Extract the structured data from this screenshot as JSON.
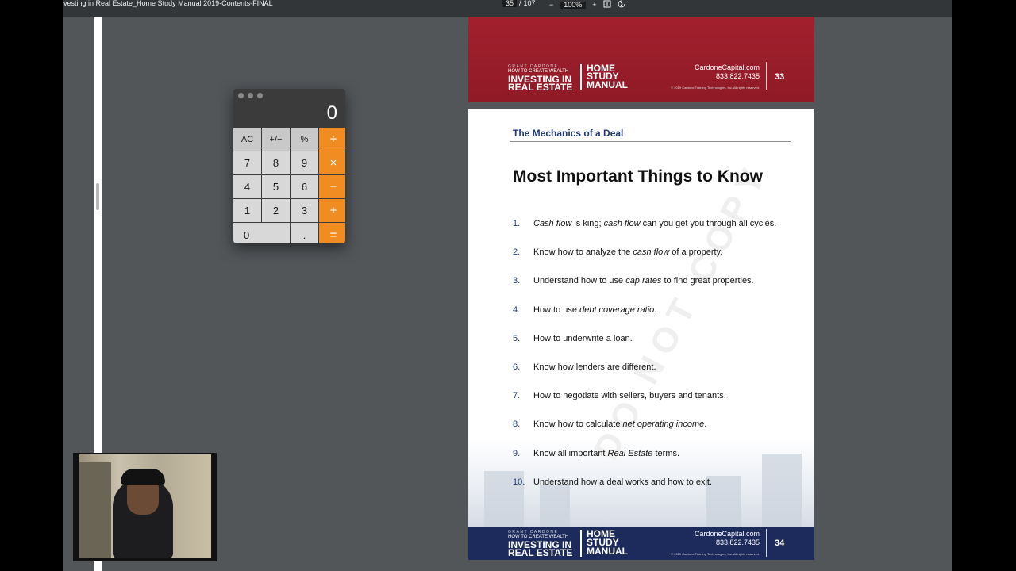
{
  "toolbar": {
    "title": "vesting in Real Estate_Home Study Manual 2019-Contents-FINAL",
    "page_current": "35",
    "page_sep": "/",
    "page_total": "107",
    "zoom_out": "−",
    "zoom": "100%",
    "zoom_in": "+"
  },
  "calculator": {
    "display": "0",
    "keys": [
      "AC",
      "+/−",
      "%",
      "÷",
      "7",
      "8",
      "9",
      "×",
      "4",
      "5",
      "6",
      "−",
      "1",
      "2",
      "3",
      "+",
      "0",
      ".",
      "="
    ],
    "accent": "#f08c21"
  },
  "header_band_top": {
    "brand_small": "GRANT CARDONE",
    "brand_line1": "HOW TO CREATE WEALTH",
    "brand_line2": "INVESTING IN",
    "brand_line3": "REAL ESTATE",
    "hsm1": "HOME",
    "hsm2": "STUDY",
    "hsm3": "MANUAL",
    "site": "CardoneCapital.com",
    "phone": "833.822.7435",
    "copyright": "© 2019 Cardone Training Technologies, Inc. All rights reserved.",
    "page_number": "33",
    "color": "#a3202e"
  },
  "page": {
    "section": "The Mechanics of a Deal",
    "heading": "Most Important Things to Know",
    "watermark": "DO NOT COPY",
    "items": [
      {
        "n": "1.",
        "parts": [
          [
            "Cash flow",
            true
          ],
          [
            " is king; ",
            false
          ],
          [
            "cash flow",
            true
          ],
          [
            " can you get you through all cycles.",
            false
          ]
        ]
      },
      {
        "n": "2.",
        "parts": [
          [
            "Know how to analyze the ",
            false
          ],
          [
            "cash flow",
            true
          ],
          [
            " of a property.",
            false
          ]
        ]
      },
      {
        "n": "3.",
        "parts": [
          [
            "Understand how to use ",
            false
          ],
          [
            "cap rates",
            true
          ],
          [
            " to find great properties.",
            false
          ]
        ]
      },
      {
        "n": "4.",
        "parts": [
          [
            "How to use ",
            false
          ],
          [
            "debt coverage ratio",
            true
          ],
          [
            ".",
            false
          ]
        ]
      },
      {
        "n": "5.",
        "parts": [
          [
            "How to underwrite a loan.",
            false
          ]
        ]
      },
      {
        "n": "6.",
        "parts": [
          [
            "Know how lenders are different.",
            false
          ]
        ]
      },
      {
        "n": "7.",
        "parts": [
          [
            "How to negotiate with sellers, buyers and tenants.",
            false
          ]
        ]
      },
      {
        "n": "8.",
        "parts": [
          [
            "Know how to calculate ",
            false
          ],
          [
            "net operating income",
            true
          ],
          [
            ".",
            false
          ]
        ]
      },
      {
        "n": "9.",
        "parts": [
          [
            "Know all important ",
            false
          ],
          [
            "Real Estate",
            true
          ],
          [
            " terms.",
            false
          ]
        ]
      },
      {
        "n": "10.",
        "parts": [
          [
            "Understand how a deal works and how to exit.",
            false
          ]
        ]
      }
    ]
  },
  "header_band_bottom": {
    "brand_small": "GRANT CARDONE",
    "brand_line1": "HOW TO CREATE WEALTH",
    "brand_line2": "INVESTING IN",
    "brand_line3": "REAL ESTATE",
    "hsm1": "HOME",
    "hsm2": "STUDY",
    "hsm3": "MANUAL",
    "site": "CardoneCapital.com",
    "phone": "833.822.7435",
    "copyright": "© 2019 Cardone Training Technologies, Inc. All rights reserved.",
    "page_number": "34",
    "color": "#1d2a5c"
  }
}
